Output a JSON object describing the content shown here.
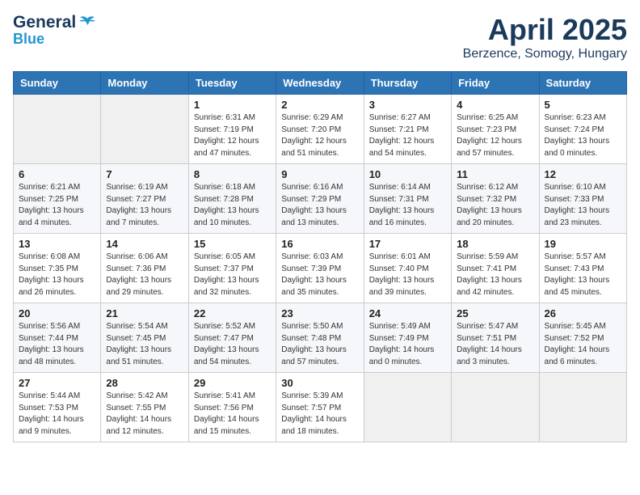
{
  "header": {
    "logo_general": "General",
    "logo_blue": "Blue",
    "month": "April 2025",
    "location": "Berzence, Somogy, Hungary"
  },
  "weekdays": [
    "Sunday",
    "Monday",
    "Tuesday",
    "Wednesday",
    "Thursday",
    "Friday",
    "Saturday"
  ],
  "weeks": [
    [
      {
        "day": "",
        "info": ""
      },
      {
        "day": "",
        "info": ""
      },
      {
        "day": "1",
        "info": "Sunrise: 6:31 AM\nSunset: 7:19 PM\nDaylight: 12 hours\nand 47 minutes."
      },
      {
        "day": "2",
        "info": "Sunrise: 6:29 AM\nSunset: 7:20 PM\nDaylight: 12 hours\nand 51 minutes."
      },
      {
        "day": "3",
        "info": "Sunrise: 6:27 AM\nSunset: 7:21 PM\nDaylight: 12 hours\nand 54 minutes."
      },
      {
        "day": "4",
        "info": "Sunrise: 6:25 AM\nSunset: 7:23 PM\nDaylight: 12 hours\nand 57 minutes."
      },
      {
        "day": "5",
        "info": "Sunrise: 6:23 AM\nSunset: 7:24 PM\nDaylight: 13 hours\nand 0 minutes."
      }
    ],
    [
      {
        "day": "6",
        "info": "Sunrise: 6:21 AM\nSunset: 7:25 PM\nDaylight: 13 hours\nand 4 minutes."
      },
      {
        "day": "7",
        "info": "Sunrise: 6:19 AM\nSunset: 7:27 PM\nDaylight: 13 hours\nand 7 minutes."
      },
      {
        "day": "8",
        "info": "Sunrise: 6:18 AM\nSunset: 7:28 PM\nDaylight: 13 hours\nand 10 minutes."
      },
      {
        "day": "9",
        "info": "Sunrise: 6:16 AM\nSunset: 7:29 PM\nDaylight: 13 hours\nand 13 minutes."
      },
      {
        "day": "10",
        "info": "Sunrise: 6:14 AM\nSunset: 7:31 PM\nDaylight: 13 hours\nand 16 minutes."
      },
      {
        "day": "11",
        "info": "Sunrise: 6:12 AM\nSunset: 7:32 PM\nDaylight: 13 hours\nand 20 minutes."
      },
      {
        "day": "12",
        "info": "Sunrise: 6:10 AM\nSunset: 7:33 PM\nDaylight: 13 hours\nand 23 minutes."
      }
    ],
    [
      {
        "day": "13",
        "info": "Sunrise: 6:08 AM\nSunset: 7:35 PM\nDaylight: 13 hours\nand 26 minutes."
      },
      {
        "day": "14",
        "info": "Sunrise: 6:06 AM\nSunset: 7:36 PM\nDaylight: 13 hours\nand 29 minutes."
      },
      {
        "day": "15",
        "info": "Sunrise: 6:05 AM\nSunset: 7:37 PM\nDaylight: 13 hours\nand 32 minutes."
      },
      {
        "day": "16",
        "info": "Sunrise: 6:03 AM\nSunset: 7:39 PM\nDaylight: 13 hours\nand 35 minutes."
      },
      {
        "day": "17",
        "info": "Sunrise: 6:01 AM\nSunset: 7:40 PM\nDaylight: 13 hours\nand 39 minutes."
      },
      {
        "day": "18",
        "info": "Sunrise: 5:59 AM\nSunset: 7:41 PM\nDaylight: 13 hours\nand 42 minutes."
      },
      {
        "day": "19",
        "info": "Sunrise: 5:57 AM\nSunset: 7:43 PM\nDaylight: 13 hours\nand 45 minutes."
      }
    ],
    [
      {
        "day": "20",
        "info": "Sunrise: 5:56 AM\nSunset: 7:44 PM\nDaylight: 13 hours\nand 48 minutes."
      },
      {
        "day": "21",
        "info": "Sunrise: 5:54 AM\nSunset: 7:45 PM\nDaylight: 13 hours\nand 51 minutes."
      },
      {
        "day": "22",
        "info": "Sunrise: 5:52 AM\nSunset: 7:47 PM\nDaylight: 13 hours\nand 54 minutes."
      },
      {
        "day": "23",
        "info": "Sunrise: 5:50 AM\nSunset: 7:48 PM\nDaylight: 13 hours\nand 57 minutes."
      },
      {
        "day": "24",
        "info": "Sunrise: 5:49 AM\nSunset: 7:49 PM\nDaylight: 14 hours\nand 0 minutes."
      },
      {
        "day": "25",
        "info": "Sunrise: 5:47 AM\nSunset: 7:51 PM\nDaylight: 14 hours\nand 3 minutes."
      },
      {
        "day": "26",
        "info": "Sunrise: 5:45 AM\nSunset: 7:52 PM\nDaylight: 14 hours\nand 6 minutes."
      }
    ],
    [
      {
        "day": "27",
        "info": "Sunrise: 5:44 AM\nSunset: 7:53 PM\nDaylight: 14 hours\nand 9 minutes."
      },
      {
        "day": "28",
        "info": "Sunrise: 5:42 AM\nSunset: 7:55 PM\nDaylight: 14 hours\nand 12 minutes."
      },
      {
        "day": "29",
        "info": "Sunrise: 5:41 AM\nSunset: 7:56 PM\nDaylight: 14 hours\nand 15 minutes."
      },
      {
        "day": "30",
        "info": "Sunrise: 5:39 AM\nSunset: 7:57 PM\nDaylight: 14 hours\nand 18 minutes."
      },
      {
        "day": "",
        "info": ""
      },
      {
        "day": "",
        "info": ""
      },
      {
        "day": "",
        "info": ""
      }
    ]
  ]
}
